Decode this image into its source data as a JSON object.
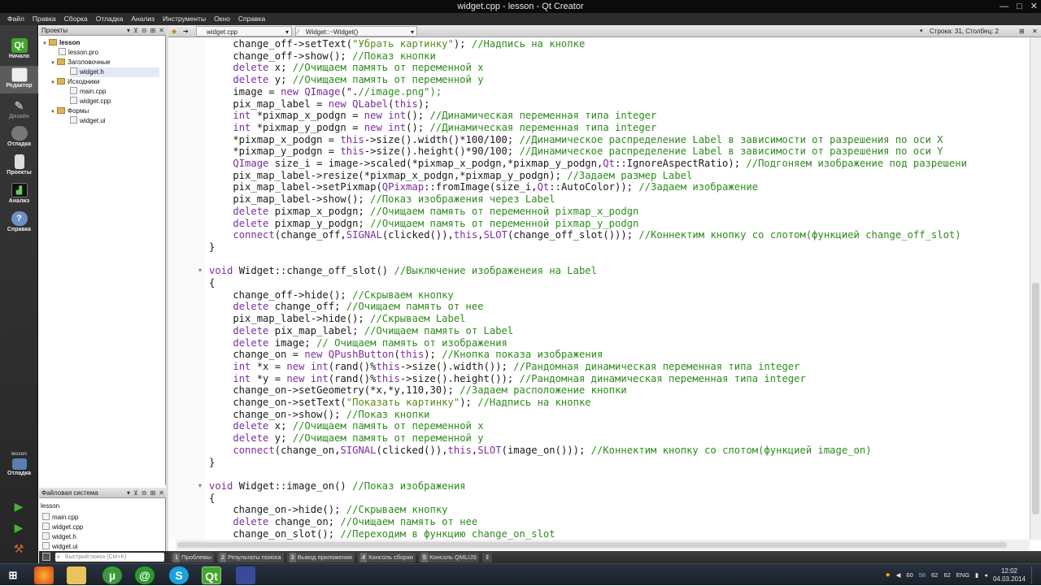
{
  "window": {
    "title": "widget.cpp - lesson - Qt Creator",
    "controls": [
      "—",
      "□",
      "✕"
    ]
  },
  "menu": [
    "Файл",
    "Правка",
    "Сборка",
    "Отладка",
    "Анализ",
    "Инструменты",
    "Окно",
    "Справка"
  ],
  "modes": [
    {
      "label": "Начало",
      "icon": "qt-logo-icon"
    },
    {
      "label": "Редактор",
      "icon": "editor-icon"
    },
    {
      "label": "Дизайн",
      "icon": "design-icon"
    },
    {
      "label": "Отладка",
      "icon": "debug-icon"
    },
    {
      "label": "Проекты",
      "icon": "projects-icon"
    },
    {
      "label": "Анализ",
      "icon": "analyze-icon"
    },
    {
      "label": "Справка",
      "icon": "help-icon"
    }
  ],
  "kit": {
    "project": "lesson",
    "label": "Отладка"
  },
  "projects_pane": {
    "header": "Проекты",
    "tree": [
      {
        "label": "lesson",
        "kind": "project"
      },
      {
        "label": "lesson.pro",
        "kind": "file"
      },
      {
        "label": "Заголовочные",
        "kind": "folder"
      },
      {
        "label": "widget.h",
        "kind": "file"
      },
      {
        "label": "Исходники",
        "kind": "folder"
      },
      {
        "label": "main.cpp",
        "kind": "file"
      },
      {
        "label": "widget.cpp",
        "kind": "file"
      },
      {
        "label": "Формы",
        "kind": "folder"
      },
      {
        "label": "widget.ui",
        "kind": "file"
      }
    ]
  },
  "fs_pane": {
    "header": "Файловая система",
    "path": "lesson",
    "files": [
      "main.cpp",
      "widget.cpp",
      "widget.h",
      "widget.ui"
    ]
  },
  "editor_toolbar": {
    "file": "widget.cpp",
    "function": "Widget::~Widget()",
    "position": "Строка: 31, Столбец: 2"
  },
  "code_lines": [
    "    change_off->setText(\"Убрать картинку\"); //Надпись на кнопке",
    "    change_off->show(); //Показ кнопки",
    "    delete x; //Очищаем память от переменной x",
    "    delete y; //Очищаем память от переменной y",
    "    image = new QImage(\".//image.png\");",
    "    pix_map_label = new QLabel(this);",
    "    int *pixmap_x_podgn = new int(); //Динамическая переменная типа integer",
    "    int *pixmap_y_podgn = new int(); //Динамическая переменная типа integer",
    "    *pixmap_x_podgn = this->size().width()*100/100; //Динамическое распределение Label в зависимости от разрешения по оси X",
    "    *pixmap_y_podgn = this->size().height()*90/100; //Динамическое распределение Label в зависимости от разрешения по оси Y",
    "    QImage size_i = image->scaled(*pixmap_x_podgn,*pixmap_y_podgn,Qt::IgnoreAspectRatio); //Подгоняем изображение под разрешени",
    "    pix_map_label->resize(*pixmap_x_podgn,*pixmap_y_podgn); //Задаем размер Label",
    "    pix_map_label->setPixmap(QPixmap::fromImage(size_i,Qt::AutoColor)); //Задаем изображение",
    "    pix_map_label->show(); //Показ изображения через Label",
    "    delete pixmap_x_podgn; //Очищаем память от переменной pixmap_x_podgn",
    "    delete pixmap_y_podgn; //Очищаем память от переменной pixmap_y_podgn",
    "    connect(change_off,SIGNAL(clicked()),this,SLOT(change_off_slot())); //Коннектим кнопку со слотом(функцией change_off_slot)",
    "}",
    "",
    "void Widget::change_off_slot() //Выключение изображенеия на Label",
    "{",
    "    change_off->hide(); //Скрываем кнопку",
    "    delete change_off; //Очищаем память от нее",
    "    pix_map_label->hide(); //Скрываем Label",
    "    delete pix_map_label; //Очищаем память от Label",
    "    delete image; // Очищаем память от изображения",
    "    change_on = new QPushButton(this); //Кнопка показа изображения",
    "    int *x = new int(rand()%this->size().width()); //Рандомная динамическая переменная типа integer",
    "    int *y = new int(rand()%this->size().height()); //Рандомная динамическая переменная типа integer",
    "    change_on->setGeometry(*x,*y,110,30); //Задаем расположение кнопки",
    "    change_on->setText(\"Показать картинку\"); //Надпись на кнопке",
    "    change_on->show(); //Показ кнопки",
    "    delete x; //Очищаем память от переменной x",
    "    delete y; //Очищаем память от переменной y",
    "    connect(change_on,SIGNAL(clicked()),this,SLOT(image_on())); //Коннектим кнопку со слотом(функцией image_on)",
    "}",
    "",
    "void Widget::image_on() //Показ изображения",
    "{",
    "    change_on->hide(); //Скрываем кнопку",
    "    delete change_on; //Очищаем память от нее",
    "    change_on_slot(); //Переходим в функцию change_on_slot"
  ],
  "locator": {
    "placeholder": "Быстрый поиск (Ctrl+K)"
  },
  "output_tabs": [
    {
      "num": "1",
      "label": "Проблемы"
    },
    {
      "num": "2",
      "label": "Результаты поиска"
    },
    {
      "num": "3",
      "label": "Вывод приложения"
    },
    {
      "num": "4",
      "label": "Консоль сборки"
    },
    {
      "num": "5",
      "label": "Консоль QML/JS"
    }
  ],
  "taskbar": {
    "apps": [
      "windows-start-icon",
      "firefox-icon",
      "explorer-icon",
      "torrent-icon",
      "mail-icon",
      "skype-icon",
      "qt-creator-icon",
      "app-icon"
    ],
    "tray_numbers": [
      "60",
      "58",
      "62",
      "62"
    ],
    "lang": "ENG",
    "time": "12:02",
    "date": "04.03.2014"
  },
  "colors": {
    "keyword": "#7b2fa0",
    "comment": "#2e8b1e",
    "string": "#5a8a1a",
    "type": "#7a2a9e"
  }
}
